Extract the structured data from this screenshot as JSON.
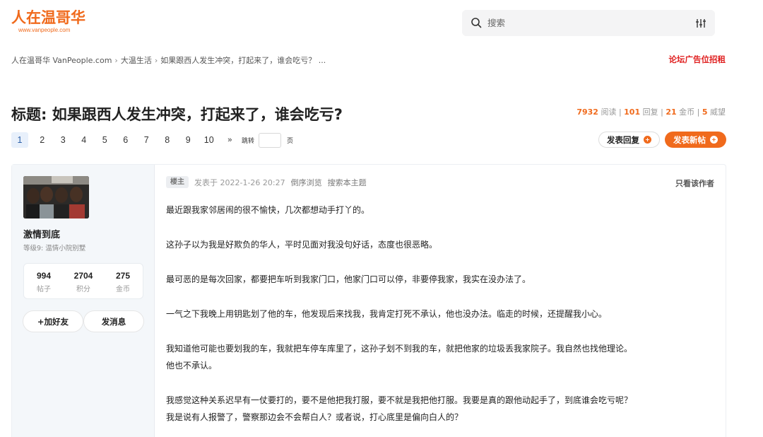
{
  "header": {
    "logo_text": "人在温哥华",
    "logo_url": "www.vanpeople.com",
    "search_placeholder": "搜索",
    "brand_color": "#f06a1c"
  },
  "breadcrumb": {
    "items": [
      "人在温哥华 VanPeople.com",
      "大温生活",
      "如果跟西人发生冲突，打起来了，谁会吃亏？ ..."
    ],
    "ad_link": "论坛广告位招租"
  },
  "thread": {
    "title": "标题: 如果跟西人发生冲突，打起来了，谁会吃亏?",
    "stats": {
      "views": "7932",
      "views_label": "阅读",
      "replies": "101",
      "replies_label": "回复",
      "coins": "21",
      "coins_label": "金币",
      "prestige": "5",
      "prestige_label": "威望"
    }
  },
  "pagination": {
    "pages": [
      "1",
      "2",
      "3",
      "4",
      "5",
      "6",
      "7",
      "8",
      "9",
      "10"
    ],
    "current": "1",
    "next": "»",
    "jump_label": "跳转",
    "page_label": "页"
  },
  "actions": {
    "reply_label": "发表回复",
    "new_label": "发表新帖"
  },
  "author": {
    "name": "激情到底",
    "level": "等级9: 温情小院别墅",
    "posts": "994",
    "posts_label": "帖子",
    "points": "2704",
    "points_label": "积分",
    "coins": "275",
    "coins_label": "金币",
    "add_friend": "+加好友",
    "send_message": "发消息"
  },
  "post": {
    "badge": "楼主",
    "posted_at": "发表于 2022-1-26 20:27",
    "reverse_order": "倒序浏览",
    "search_thread": "搜索本主题",
    "only_author": "只看该作者",
    "paragraphs": [
      "最近跟我家邻居闹的很不愉快，几次都想动手打丫的。",
      "这孙子以为我是好欺负的华人，平时见面对我没句好话，态度也很恶略。",
      "最可恶的是每次回家，都要把车听到我家门口，他家门口可以停，非要停我家，我实在没办法了。",
      "一气之下我晚上用钥匙划了他的车，他发现后来找我，我肯定打死不承认，他也没办法。临走的时候，还提醒我小心。",
      "我知道他可能也要划我的车，我就把车停车库里了，这孙子划不到我的车，就把他家的垃圾丢我家院子。我自然也找他理论。他也不承认。",
      "我感觉这种关系迟早有一仗要打的，要不是他把我打服，要不就是我把他打服。我要是真的跟他动起手了，到底谁会吃亏呢？我是说有人报警了，警察那边会不会帮白人？或者说，打心底里是偏向白人的？"
    ]
  }
}
